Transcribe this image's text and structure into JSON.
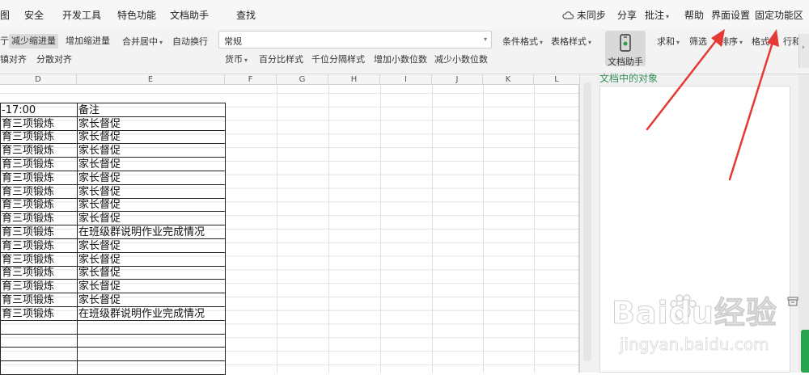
{
  "menu": {
    "items": [
      "图",
      "安全",
      "开发工具",
      "特色功能",
      "文档助手",
      "查找"
    ],
    "sync_label": "未同步",
    "share_label": "分享",
    "comment_label": "批注",
    "help_label": "帮助",
    "ui_settings_label": "界面设置",
    "fixed_area_label": "固定功能区"
  },
  "toolbar": {
    "indent_prefix": "亍",
    "decrease_indent": "减少缩进量",
    "increase_indent": "增加缩进量",
    "merge_center": "合并居中",
    "auto_wrap": "自动换行",
    "distributed_align_partial": "镇对齐",
    "distributed_align": "分散对齐",
    "number_format_value": "常规",
    "currency": "货币",
    "percent_style": "百分比样式",
    "thousands_style": "千位分隔样式",
    "increase_decimal": "增加小数位数",
    "decrease_decimal": "减少小数位数",
    "conditional_format": "条件格式",
    "table_style": "表格样式",
    "doc_assistant": "文档助手",
    "sum": "求和",
    "filter": "筛选",
    "sort": "排序",
    "format": "格式",
    "row_col": "行和"
  },
  "grid": {
    "columns": [
      "D",
      "E",
      "F",
      "G",
      "H",
      "I",
      "J",
      "K",
      "L"
    ],
    "rows": [
      [
        "-17:00",
        "备注"
      ],
      [
        "育三项锻炼",
        "家长督促"
      ],
      [
        "育三项锻炼",
        "家长督促"
      ],
      [
        "育三项锻炼",
        "家长督促"
      ],
      [
        "育三项锻炼",
        "家长督促"
      ],
      [
        "育三项锻炼",
        "家长督促"
      ],
      [
        "育三项锻炼",
        "家长督促"
      ],
      [
        "育三项锻炼",
        "家长督促"
      ],
      [
        "育三项锻炼",
        "家长督促"
      ],
      [
        "育三项锻炼",
        "在班级群说明作业完成情况"
      ],
      [
        "育三项锻炼",
        "家长督促"
      ],
      [
        "育三项锻炼",
        "家长督促"
      ],
      [
        "育三项锻炼",
        "家长督促"
      ],
      [
        "育三项锻炼",
        "家长督促"
      ],
      [
        "育三项锻炼",
        "家长督促"
      ],
      [
        "育三项锻炼",
        "在班级群说明作业完成情况"
      ],
      [
        "",
        ""
      ],
      [
        "",
        ""
      ],
      [
        "",
        ""
      ],
      [
        "",
        ""
      ]
    ]
  },
  "pane": {
    "title_partial": "文档中的对象"
  },
  "watermark": {
    "brand": "Baidu经验",
    "url": "jingyan.baidu.com"
  },
  "colors": {
    "arrow": "#e53935",
    "accent_green": "#27a24d"
  }
}
